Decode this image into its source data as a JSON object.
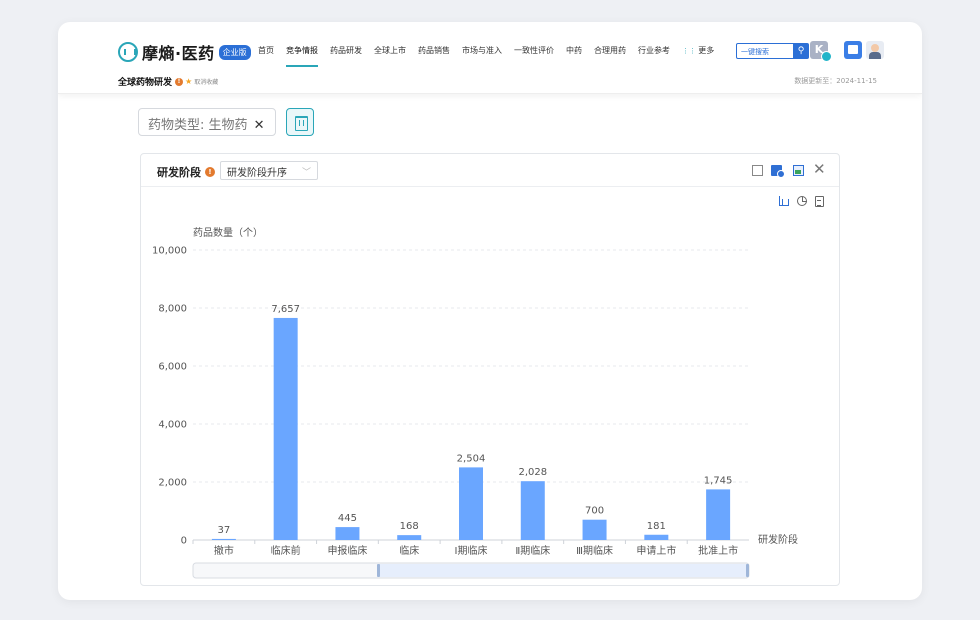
{
  "header": {
    "logo_text": "摩熵·医药",
    "logo_badge": "企业版",
    "nav": [
      "首页",
      "竞争情报",
      "药品研发",
      "全球上市",
      "药品销售",
      "市场与准入",
      "一致性评价",
      "中药",
      "合理用药",
      "行业参考",
      "更多"
    ],
    "active_nav_index": 1,
    "search_placeholder": "一键搜索",
    "page_title": "全球药物研发",
    "cancel_favorite": "取消收藏",
    "update_text": "数据更新至：2024-11-15"
  },
  "filter": {
    "chip_label": "药物类型: 生物药",
    "chip_close": "✕"
  },
  "panel": {
    "title": "研发阶段",
    "sort_value": "研发阶段升序",
    "close_glyph": "✕"
  },
  "colors": {
    "accent": "#2aa6b8",
    "bar": "#6aa6ff",
    "brand_blue": "#2b6fd6"
  },
  "chart_data": {
    "type": "bar",
    "categories": [
      "撤市",
      "临床前",
      "申报临床",
      "临床",
      "Ⅰ期临床",
      "Ⅱ期临床",
      "Ⅲ期临床",
      "申请上市",
      "批准上市"
    ],
    "values": [
      37,
      7657,
      445,
      168,
      2504,
      2028,
      700,
      181,
      1745
    ],
    "value_labels": [
      "37",
      "7,657",
      "445",
      "168",
      "2,504",
      "2,028",
      "700",
      "181",
      "1,745"
    ],
    "ylabel": "药品数量（个）",
    "xlabel": "研发阶段",
    "ylim": [
      0,
      10000
    ],
    "yticks": [
      "0",
      "2,000",
      "4,000",
      "6,000",
      "8,000",
      "10,000"
    ],
    "grid": true
  }
}
